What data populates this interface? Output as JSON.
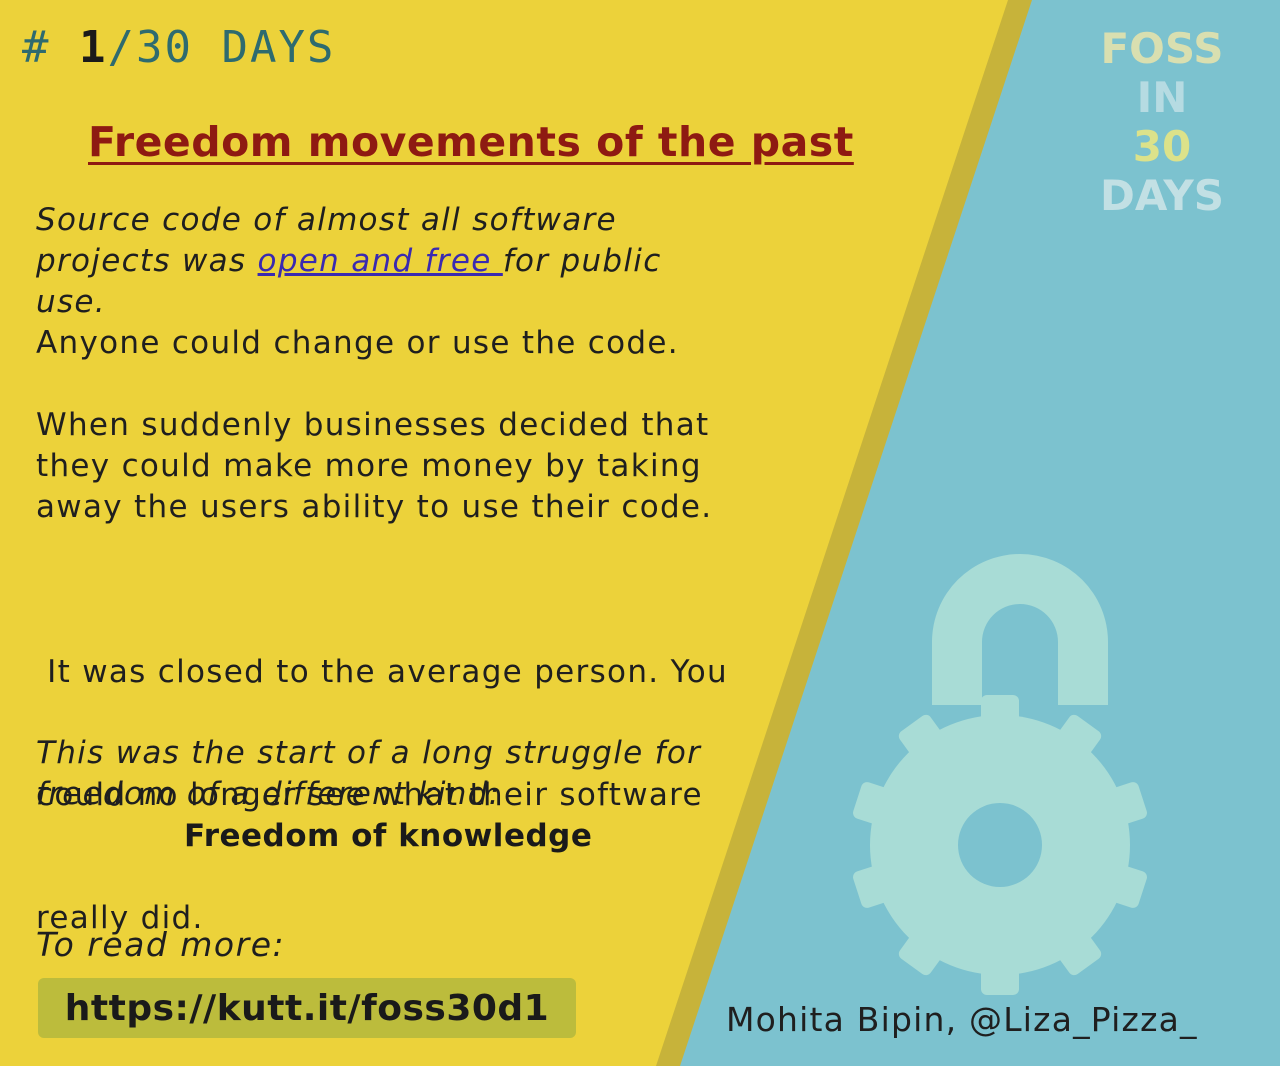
{
  "header": {
    "hash": "#",
    "day_number": "1",
    "total": "/30 DAYS"
  },
  "title": "Freedom movements of the past",
  "para1": {
    "line1": "Source code of almost all software",
    "line2_before": "projects was ",
    "line2_link": "open and free ",
    "line2_after": "for public",
    "line3": "use.",
    "line4": "Anyone could change or use the code."
  },
  "para2": {
    "line1": "When suddenly businesses decided that",
    "line2": "they could make more money by taking",
    "line3": "away the users ability to use their code."
  },
  "para3": {
    "line1": " It was closed to the average person. You",
    "line2": "could no longer see what their software",
    "line3": "really did."
  },
  "para4": {
    "line1": "This was the start of a long struggle for",
    "line2": "freedom of a different kind:",
    "emphasis": "Freedom of knowledge"
  },
  "read_more": {
    "label": "To read more:",
    "url": "https://kutt.it/foss30d1"
  },
  "badge": {
    "line1": "FOSS",
    "line2": "IN",
    "line3": "30",
    "line4": "DAYS"
  },
  "author": "Mohita Bipin, @Liza_Pizza_",
  "icons": {
    "lock": "open-padlock-gear-icon"
  },
  "colors": {
    "yellow_panel": "#ecd23a",
    "teal_panel": "#7cc2cf",
    "divider": "#c7b33a",
    "title": "#8e1a12",
    "link": "#3a2ab0",
    "lock": "#a8dcd6"
  }
}
